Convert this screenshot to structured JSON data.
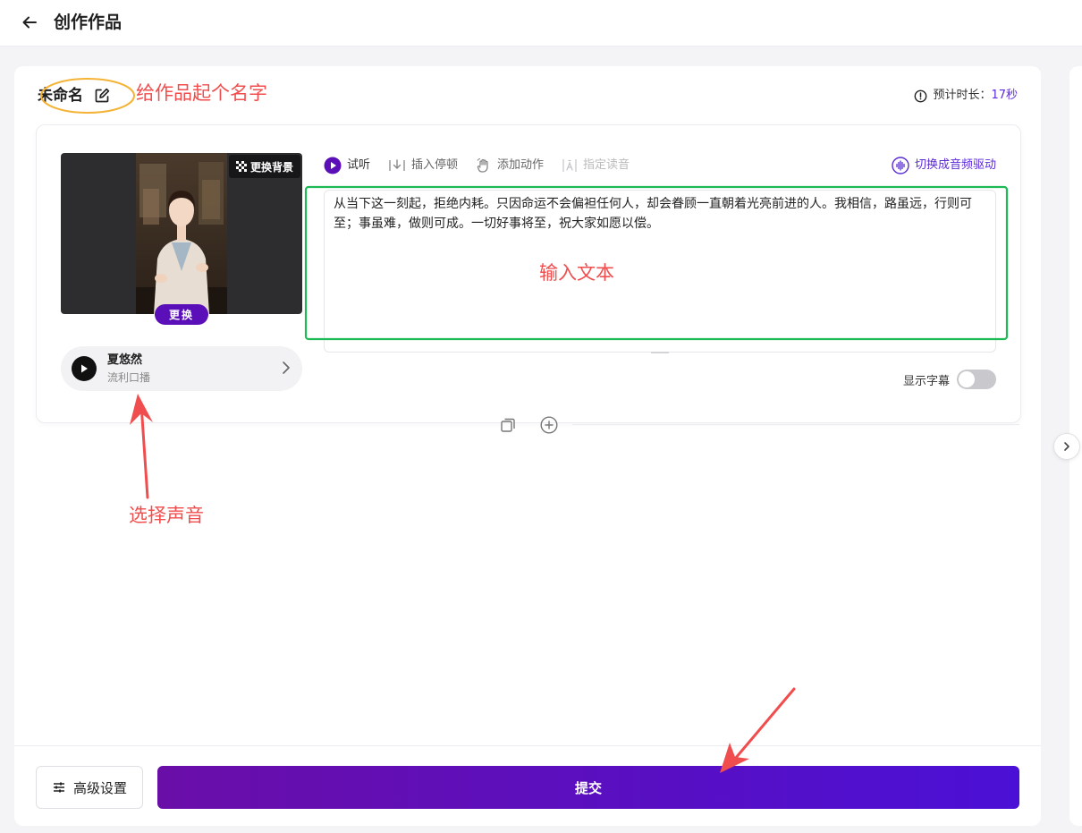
{
  "header": {
    "title": "创作作品"
  },
  "work": {
    "name": "未命名",
    "duration_label": "预计时长：",
    "duration_value": "17秒"
  },
  "avatar": {
    "change_bg_label": "更换背景",
    "replace_label": "更换"
  },
  "voice": {
    "name": "夏悠然",
    "style": "流利口播"
  },
  "toolbar": {
    "items": [
      {
        "label": "试听",
        "icon": "play-circle-icon"
      },
      {
        "label": "插入停顿",
        "icon": "insert-pause-icon"
      },
      {
        "label": "添加动作",
        "icon": "gesture-hand-icon"
      },
      {
        "label": "指定读音",
        "icon": "pronunciation-icon"
      }
    ],
    "switch_driver_label": "切换成音频驱动"
  },
  "script": {
    "text": "从当下这一刻起，拒绝内耗。只因命运不会偏袒任何人，却会眷顾一直朝着光亮前进的人。我相信，路虽远，行则可至；事虽难，做则可成。一切好事将至，祝大家如愿以偿。"
  },
  "subtitles": {
    "label": "显示字幕",
    "enabled": false
  },
  "footer": {
    "advanced_label": "高级设置",
    "submit_label": "提交"
  },
  "annotations": {
    "name_hint": "给作品起个名字",
    "text_hint": "输入文本",
    "voice_hint": "选择声音"
  },
  "colors": {
    "accent": "#5b2bd6",
    "submit_gradient_start": "#6a0ea8",
    "submit_gradient_end": "#4b10d6",
    "annotation_red": "#f04e4e",
    "annotation_green": "#1db954",
    "annotation_orange": "#f5b335"
  }
}
